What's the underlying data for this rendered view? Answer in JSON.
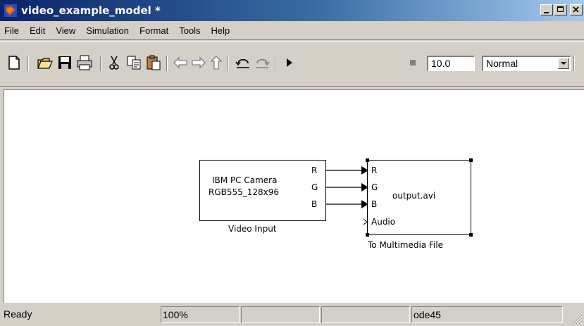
{
  "window": {
    "title": "video_example_model *",
    "minimize_icon": "minimize-icon",
    "maximize_icon": "maximize-icon",
    "close_icon": "close-icon"
  },
  "menu": [
    "File",
    "Edit",
    "View",
    "Simulation",
    "Format",
    "Tools",
    "Help"
  ],
  "toolbar": {
    "icons": [
      "new-icon",
      "open-icon",
      "save-icon",
      "print-icon",
      "cut-icon",
      "copy-icon",
      "paste-icon",
      "back-icon",
      "forward-icon",
      "up-icon",
      "undo-icon",
      "redo-icon",
      "start-icon",
      "stop-icon"
    ],
    "stop_time": "10.0",
    "sim_mode": "Normal"
  },
  "blocks": {
    "video_input": {
      "line1": "IBM PC Camera",
      "line2": "RGB555_128x96",
      "ports": [
        "R",
        "G",
        "B"
      ],
      "name": "Video Input"
    },
    "to_file": {
      "ports": [
        "R",
        "G",
        "B",
        "Audio"
      ],
      "file": "output.avi",
      "name": "To Multimedia File"
    }
  },
  "status": {
    "text": "Ready",
    "zoom": "100%",
    "cell3": "",
    "cell4": "",
    "solver": "ode45"
  },
  "colors": {
    "title_start": "#0a246a",
    "title_end": "#a6caf0",
    "chrome": "#d4d0c8"
  }
}
